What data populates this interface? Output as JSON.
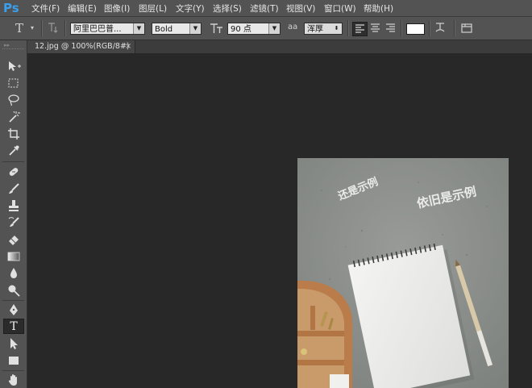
{
  "app": {
    "logo": "Ps"
  },
  "menu": {
    "items": [
      "文件(F)",
      "编辑(E)",
      "图像(I)",
      "图层(L)",
      "文字(Y)",
      "选择(S)",
      "滤镜(T)",
      "视图(V)",
      "窗口(W)",
      "帮助(H)"
    ]
  },
  "options": {
    "font_family": "阿里巴巴普...",
    "font_style": "Bold",
    "font_size": "90 点",
    "antialias_label": "aa",
    "antialias": "浑厚",
    "text_color": "#ffffff"
  },
  "document": {
    "tab_title": "12.jpg @ 100%(RGB/8#)",
    "close_glyph": "×"
  },
  "canvas_text": {
    "text1": "还是示例",
    "text2": "依旧是示例"
  },
  "colors": {
    "accent": "#3aa0ee",
    "ui_bg": "#535353",
    "workspace": "#282828"
  }
}
